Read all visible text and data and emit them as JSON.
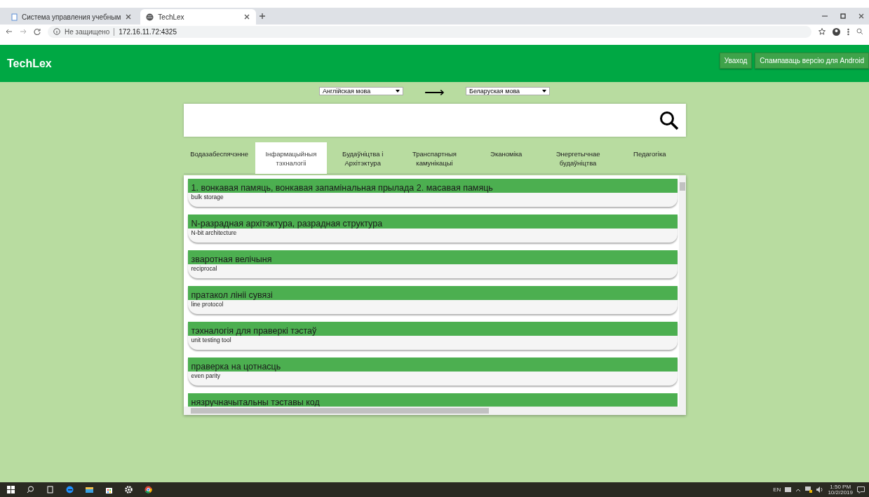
{
  "browser": {
    "tabs": [
      {
        "title": "Система управления учебным",
        "selected": false
      },
      {
        "title": "TechLex",
        "selected": true
      }
    ],
    "security": "Не защищено",
    "address": "172.16.11.72:4325"
  },
  "header": {
    "logo": "TechLex",
    "buttons": [
      "Уваход",
      "Спампаваць версію для Android"
    ]
  },
  "languages": {
    "from": "Англійская мова",
    "arrow": "⟶",
    "to": "Беларуская мова"
  },
  "categories": [
    {
      "label": "Водазабеспячэнне",
      "selected": false
    },
    {
      "label": "Інфармацыйныя тэхналогіі",
      "selected": true
    },
    {
      "label": "Будаўніцтва і Архітэктура",
      "selected": false
    },
    {
      "label": "Транспартныя камунікацыі",
      "selected": false
    },
    {
      "label": "Эканоміка",
      "selected": false
    },
    {
      "label": "Энергетычнае будаўніцтва",
      "selected": false
    },
    {
      "label": "Педагогіка",
      "selected": false
    }
  ],
  "terms": [
    {
      "term": "1. вонкавая памяць, вонкавая запамінальная прылада 2. масавая памяць",
      "translation": "bulk storage"
    },
    {
      "term": "N-разрадная архітэктура, разрадная структура",
      "translation": "N-bit architecture"
    },
    {
      "term": "зваротная велічыня",
      "translation": "reciprocal"
    },
    {
      "term": "пратакол лініі сувязі",
      "translation": "line protocol"
    },
    {
      "term": "тэхналогія для праверкі тэстаў",
      "translation": "unit testing tool"
    },
    {
      "term": "праверка на цотнасць",
      "translation": "even parity"
    },
    {
      "term": "нязручначытальны тэставы код"
    }
  ],
  "taskbar": {
    "language": "EN",
    "time": "1:50 PM",
    "date": "10/2/2019"
  }
}
